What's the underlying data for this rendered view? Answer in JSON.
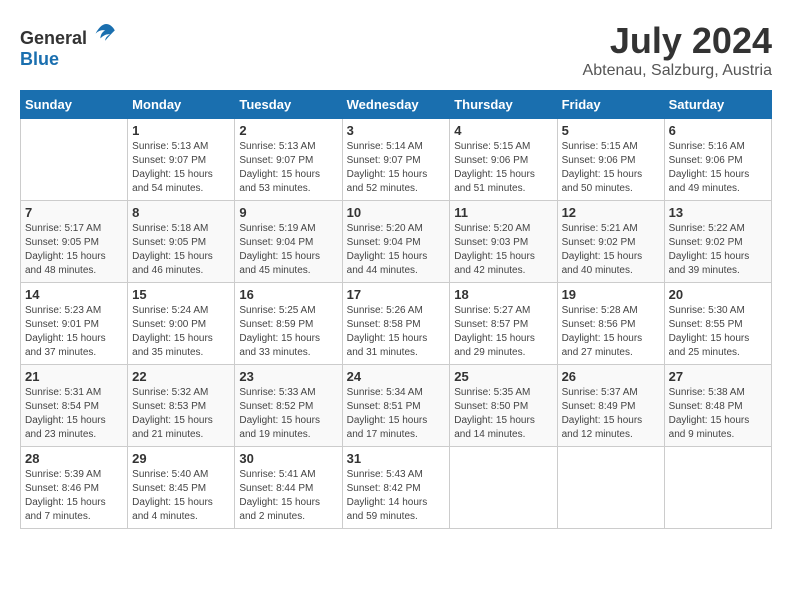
{
  "header": {
    "logo_general": "General",
    "logo_blue": "Blue",
    "month_year": "July 2024",
    "location": "Abtenau, Salzburg, Austria"
  },
  "columns": [
    "Sunday",
    "Monday",
    "Tuesday",
    "Wednesday",
    "Thursday",
    "Friday",
    "Saturday"
  ],
  "weeks": [
    [
      {
        "day": "",
        "info": ""
      },
      {
        "day": "1",
        "info": "Sunrise: 5:13 AM\nSunset: 9:07 PM\nDaylight: 15 hours\nand 54 minutes."
      },
      {
        "day": "2",
        "info": "Sunrise: 5:13 AM\nSunset: 9:07 PM\nDaylight: 15 hours\nand 53 minutes."
      },
      {
        "day": "3",
        "info": "Sunrise: 5:14 AM\nSunset: 9:07 PM\nDaylight: 15 hours\nand 52 minutes."
      },
      {
        "day": "4",
        "info": "Sunrise: 5:15 AM\nSunset: 9:06 PM\nDaylight: 15 hours\nand 51 minutes."
      },
      {
        "day": "5",
        "info": "Sunrise: 5:15 AM\nSunset: 9:06 PM\nDaylight: 15 hours\nand 50 minutes."
      },
      {
        "day": "6",
        "info": "Sunrise: 5:16 AM\nSunset: 9:06 PM\nDaylight: 15 hours\nand 49 minutes."
      }
    ],
    [
      {
        "day": "7",
        "info": "Sunrise: 5:17 AM\nSunset: 9:05 PM\nDaylight: 15 hours\nand 48 minutes."
      },
      {
        "day": "8",
        "info": "Sunrise: 5:18 AM\nSunset: 9:05 PM\nDaylight: 15 hours\nand 46 minutes."
      },
      {
        "day": "9",
        "info": "Sunrise: 5:19 AM\nSunset: 9:04 PM\nDaylight: 15 hours\nand 45 minutes."
      },
      {
        "day": "10",
        "info": "Sunrise: 5:20 AM\nSunset: 9:04 PM\nDaylight: 15 hours\nand 44 minutes."
      },
      {
        "day": "11",
        "info": "Sunrise: 5:20 AM\nSunset: 9:03 PM\nDaylight: 15 hours\nand 42 minutes."
      },
      {
        "day": "12",
        "info": "Sunrise: 5:21 AM\nSunset: 9:02 PM\nDaylight: 15 hours\nand 40 minutes."
      },
      {
        "day": "13",
        "info": "Sunrise: 5:22 AM\nSunset: 9:02 PM\nDaylight: 15 hours\nand 39 minutes."
      }
    ],
    [
      {
        "day": "14",
        "info": "Sunrise: 5:23 AM\nSunset: 9:01 PM\nDaylight: 15 hours\nand 37 minutes."
      },
      {
        "day": "15",
        "info": "Sunrise: 5:24 AM\nSunset: 9:00 PM\nDaylight: 15 hours\nand 35 minutes."
      },
      {
        "day": "16",
        "info": "Sunrise: 5:25 AM\nSunset: 8:59 PM\nDaylight: 15 hours\nand 33 minutes."
      },
      {
        "day": "17",
        "info": "Sunrise: 5:26 AM\nSunset: 8:58 PM\nDaylight: 15 hours\nand 31 minutes."
      },
      {
        "day": "18",
        "info": "Sunrise: 5:27 AM\nSunset: 8:57 PM\nDaylight: 15 hours\nand 29 minutes."
      },
      {
        "day": "19",
        "info": "Sunrise: 5:28 AM\nSunset: 8:56 PM\nDaylight: 15 hours\nand 27 minutes."
      },
      {
        "day": "20",
        "info": "Sunrise: 5:30 AM\nSunset: 8:55 PM\nDaylight: 15 hours\nand 25 minutes."
      }
    ],
    [
      {
        "day": "21",
        "info": "Sunrise: 5:31 AM\nSunset: 8:54 PM\nDaylight: 15 hours\nand 23 minutes."
      },
      {
        "day": "22",
        "info": "Sunrise: 5:32 AM\nSunset: 8:53 PM\nDaylight: 15 hours\nand 21 minutes."
      },
      {
        "day": "23",
        "info": "Sunrise: 5:33 AM\nSunset: 8:52 PM\nDaylight: 15 hours\nand 19 minutes."
      },
      {
        "day": "24",
        "info": "Sunrise: 5:34 AM\nSunset: 8:51 PM\nDaylight: 15 hours\nand 17 minutes."
      },
      {
        "day": "25",
        "info": "Sunrise: 5:35 AM\nSunset: 8:50 PM\nDaylight: 15 hours\nand 14 minutes."
      },
      {
        "day": "26",
        "info": "Sunrise: 5:37 AM\nSunset: 8:49 PM\nDaylight: 15 hours\nand 12 minutes."
      },
      {
        "day": "27",
        "info": "Sunrise: 5:38 AM\nSunset: 8:48 PM\nDaylight: 15 hours\nand 9 minutes."
      }
    ],
    [
      {
        "day": "28",
        "info": "Sunrise: 5:39 AM\nSunset: 8:46 PM\nDaylight: 15 hours\nand 7 minutes."
      },
      {
        "day": "29",
        "info": "Sunrise: 5:40 AM\nSunset: 8:45 PM\nDaylight: 15 hours\nand 4 minutes."
      },
      {
        "day": "30",
        "info": "Sunrise: 5:41 AM\nSunset: 8:44 PM\nDaylight: 15 hours\nand 2 minutes."
      },
      {
        "day": "31",
        "info": "Sunrise: 5:43 AM\nSunset: 8:42 PM\nDaylight: 14 hours\nand 59 minutes."
      },
      {
        "day": "",
        "info": ""
      },
      {
        "day": "",
        "info": ""
      },
      {
        "day": "",
        "info": ""
      }
    ]
  ]
}
